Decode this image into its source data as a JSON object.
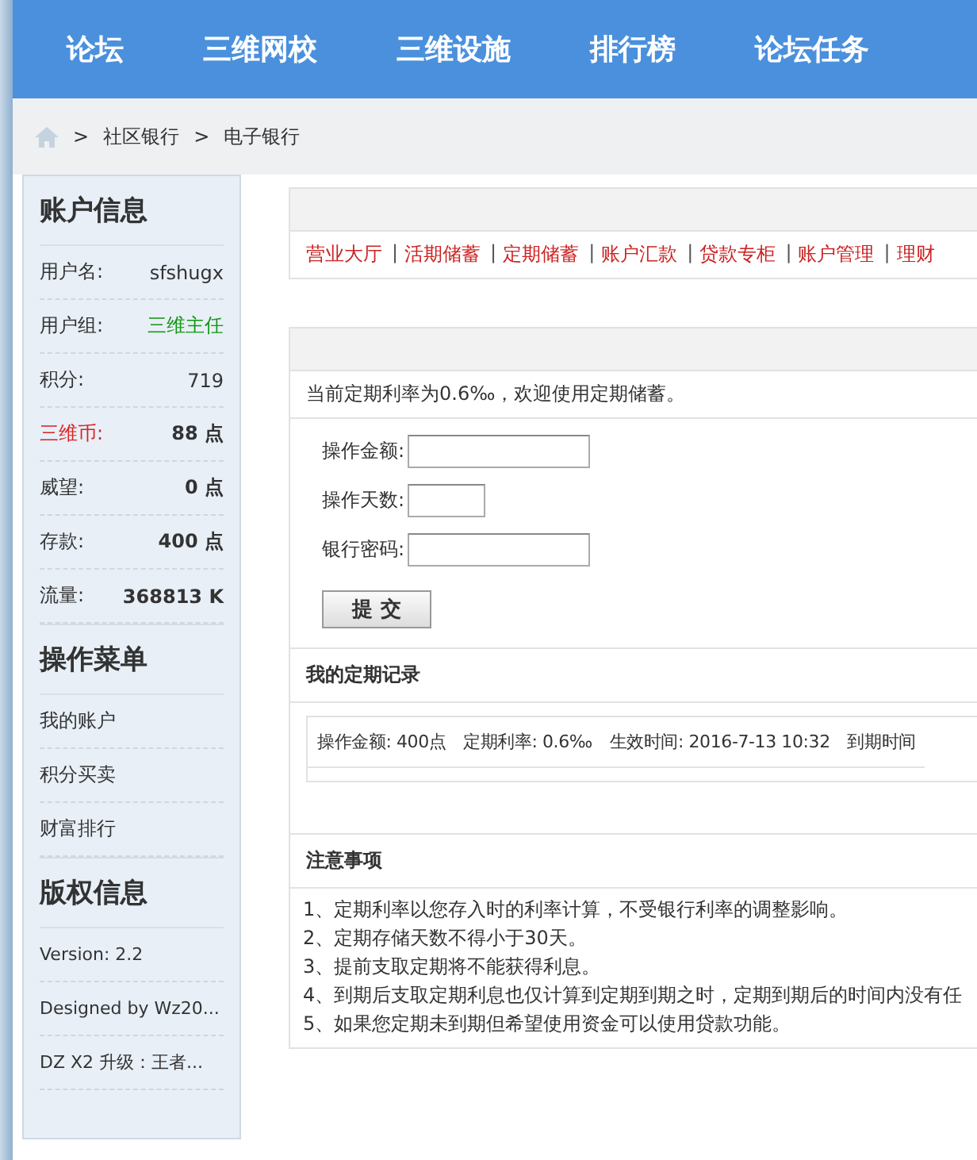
{
  "nav": [
    "论坛",
    "三维网校",
    "三维设施",
    "排行榜",
    "论坛任务"
  ],
  "breadcrumb": [
    {
      "separator": ">",
      "label": "社区银行"
    },
    {
      "separator": ">",
      "label": "电子银行"
    }
  ],
  "sidebar": [
    {
      "title": "账户信息",
      "rows": [
        {
          "kind": "text",
          "label": "用户名:",
          "value": "sfshugx"
        },
        {
          "kind": "group",
          "label": "用户组:",
          "value": "三维主任"
        },
        {
          "kind": "text",
          "label": "积分:",
          "value": "719"
        },
        {
          "kind": "coin",
          "label": "三维币:",
          "value": "88 点"
        },
        {
          "kind": "points",
          "label": "威望:",
          "value": "0 点"
        },
        {
          "kind": "points",
          "label": "存款:",
          "value": "400 点"
        },
        {
          "kind": "points",
          "label": "流量:",
          "value": "368813 K"
        }
      ]
    },
    {
      "title": "操作菜单",
      "links": [
        "我的账户",
        "积分买卖",
        "财富排行"
      ]
    },
    {
      "title": "版权信息",
      "lines": [
        "Version: 2.2",
        "Designed by Wz20...",
        "DZ X2 升级：王者..."
      ]
    }
  ],
  "bank_tabs": [
    "营业大厅",
    "活期储蓄",
    "定期储蓄",
    "账户汇款",
    "贷款专柜",
    "账户管理",
    "理财"
  ],
  "tab_separators": [
    "|",
    "|",
    "|",
    "|",
    "|",
    "|"
  ],
  "notice": "当前定期利率为0.6‰，欢迎使用定期储蓄。",
  "form": {
    "fields": [
      {
        "label": "操作金额:",
        "kind": "long"
      },
      {
        "label": "操作天数:",
        "kind": "short"
      },
      {
        "label": "银行密码:",
        "kind": "long"
      }
    ],
    "submit": "提 交"
  },
  "records": {
    "title": "我的定期记录",
    "entry": "操作金额: 400点　定期利率: 0.6‰　生效时间: 2016-7-13 10:32　到期时间"
  },
  "notes": {
    "title": "注意事项",
    "items": [
      "1、定期利率以您存入时的利率计算，不受银行利率的调整影响。",
      "2、定期存储天数不得小于30天。",
      "3、提前支取定期将不能获得利息。",
      "4、到期后支取定期利息也仅计算到定期到期之时，定期到期后的时间内没有任",
      "5、如果您定期未到期但希望使用资金可以使用贷款功能。"
    ]
  }
}
